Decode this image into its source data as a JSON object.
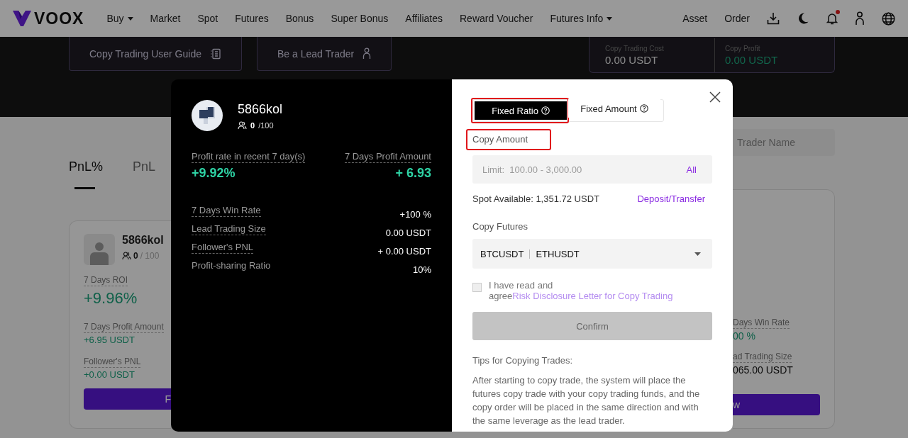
{
  "nav": {
    "logo": "VOOX",
    "notification_dot": true,
    "items": [
      {
        "label": "Buy",
        "dropdown": true
      },
      {
        "label": "Market",
        "dropdown": false
      },
      {
        "label": "Spot",
        "dropdown": false
      },
      {
        "label": "Futures",
        "dropdown": false
      },
      {
        "label": "Bonus",
        "dropdown": false
      },
      {
        "label": "Super Bonus",
        "dropdown": false
      },
      {
        "label": "Affiliates",
        "dropdown": false
      },
      {
        "label": "Reward Voucher",
        "dropdown": false
      },
      {
        "label": "Futures Info",
        "dropdown": true
      }
    ],
    "right_items": [
      "Asset",
      "Order"
    ]
  },
  "hero": {
    "buttons": [
      {
        "label": "Copy Trading User Guide",
        "kind": "guide"
      },
      {
        "label": "Be a Lead Trader",
        "kind": "trader"
      }
    ],
    "stats": [
      {
        "label": "Copy Trading Cost",
        "value": "0.00 USDT",
        "positive": false
      },
      {
        "label": "Copy Profit",
        "value": "0.00 USDT",
        "positive": true
      }
    ]
  },
  "ranking_tabs": [
    {
      "label": "PnL%",
      "selected": true
    },
    {
      "label": "PnL",
      "selected": false
    }
  ],
  "search": {
    "placeholder": "Trader Name"
  },
  "left_card": {
    "name": "5866kol",
    "followers": "0",
    "capacity": "/ 100",
    "metrics": [
      {
        "label": "7 Days ROI",
        "value": "+9.96%",
        "kind": "big"
      },
      {
        "label": "7 Days Profit Amount",
        "value": "+6.95 USDT",
        "kind": "small"
      },
      {
        "label": "Follower's PNL",
        "value": "+0.00 USDT",
        "kind": "small"
      }
    ],
    "button": "F"
  },
  "right_card": {
    "metrics": [
      {
        "label": "Days Win Rate",
        "value": "00 %",
        "positive": true
      },
      {
        "label": "ad Trading Size",
        "value": "065.00 USDT",
        "positive": false
      }
    ],
    "button": "w"
  },
  "modal": {
    "trader": {
      "name": "5866kol",
      "followers": "0",
      "capacity": "/100"
    },
    "top_metrics": [
      {
        "label": "Profit rate in recent 7 day(s)",
        "value": "+9.92%"
      },
      {
        "label": "7 Days Profit Amount",
        "value": "+ 6.93"
      }
    ],
    "rows": [
      {
        "label": "7 Days Win Rate",
        "value": "+100 %",
        "underlined": true
      },
      {
        "label": "Lead Trading Size",
        "value": "0.00 USDT",
        "underlined": true
      },
      {
        "label": "Follower's PNL",
        "value": "+ 0.00 USDT",
        "underlined": true
      },
      {
        "label": "Profit-sharing Ratio",
        "value": "10%",
        "underlined": false
      }
    ],
    "mode_tabs": [
      {
        "label": "Fixed Ratio",
        "selected": true,
        "highlighted": true
      },
      {
        "label": "Fixed Amount",
        "selected": false,
        "highlighted": false
      }
    ],
    "copy_amount": {
      "label": "Copy Amount",
      "highlighted": true,
      "placeholder": "Limit:  100.00 - 3,000.00",
      "all_link": "All"
    },
    "spot_available": "Spot Available: 1,351.72 USDT",
    "deposit_link": "Deposit/Transfer",
    "copy_futures": {
      "label": "Copy Futures",
      "values": [
        "BTCUSDT",
        "ETHUSDT"
      ]
    },
    "agreement": {
      "checked": false,
      "text": "I have read and agree",
      "link": "Risk Disclosure Letter for Copy Trading"
    },
    "confirm": {
      "label": "Confirm",
      "disabled": true
    },
    "tips_title": "Tips for Copying Trades:",
    "tips_body": "After starting to copy trade, the system will place the futures copy trade with your copy trading funds, and the copy order will be placed in the same direction and with the same leverage as the lead trader."
  }
}
